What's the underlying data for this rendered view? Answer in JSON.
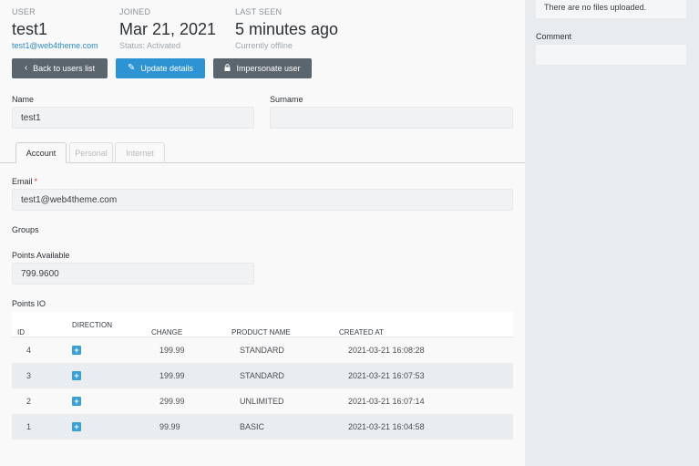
{
  "header": {
    "user": {
      "label": "USER",
      "value": "test1",
      "sub": "test1@web4theme.com"
    },
    "joined": {
      "label": "JOINED",
      "value": "Mar 21, 2021",
      "sub": "Status: Activated"
    },
    "last_seen": {
      "label": "LAST SEEN",
      "value": "5 minutes ago",
      "sub": "Currently offline"
    }
  },
  "actions": {
    "back": "Back to users list",
    "update": "Update details",
    "impersonate": "Impersonate user"
  },
  "form": {
    "name_label": "Name",
    "name_value": "test1",
    "surname_label": "Surname",
    "surname_value": "",
    "tabs": [
      "Account",
      "Personal",
      "Internet"
    ],
    "email_label": "Email",
    "email_required": "*",
    "email_value": "test1@web4theme.com",
    "groups_label": "Groups",
    "points_label": "Points Available",
    "points_value": "799.9600",
    "points_io_label": "Points IO"
  },
  "points_table": {
    "columns": [
      "ID",
      "DIRECTION",
      "CHANGE",
      "PRODUCT NAME",
      "CREATED AT"
    ],
    "rows": [
      {
        "id": "4",
        "direction": "+",
        "change": "199.99",
        "product": "STANDARD",
        "created": "2021-03-21 16:08:28"
      },
      {
        "id": "3",
        "direction": "+",
        "change": "199.99",
        "product": "STANDARD",
        "created": "2021-03-21 16:07:53"
      },
      {
        "id": "2",
        "direction": "+",
        "change": "299.99",
        "product": "UNLIMITED",
        "created": "2021-03-21 16:07:14"
      },
      {
        "id": "1",
        "direction": "+",
        "change": "99.99",
        "product": "BASIC",
        "created": "2021-03-21 16:04:58"
      }
    ]
  },
  "sidebar": {
    "files_text": "There are no files uploaded.",
    "comment_label": "Comment",
    "comment_value": ""
  },
  "colors": {
    "accent": "#2d93d3",
    "dark_button": "#5b656e",
    "required": "#d0333a",
    "link": "#2e8ccb"
  }
}
